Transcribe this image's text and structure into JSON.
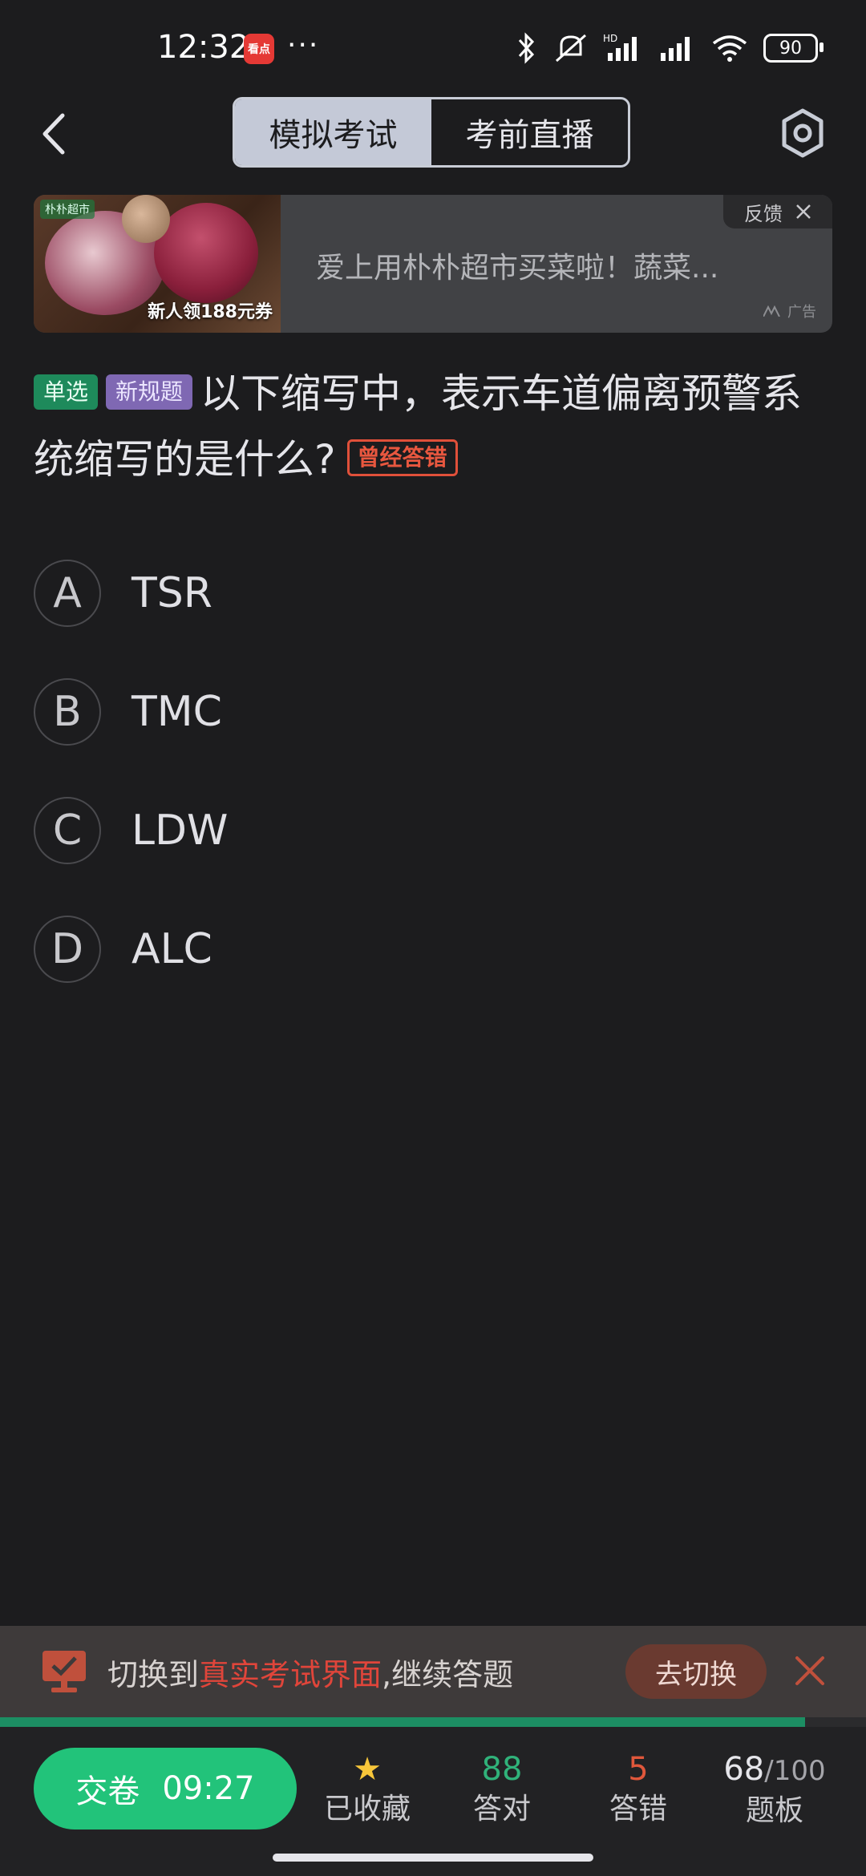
{
  "status_bar": {
    "time": "12:32",
    "app_badge": "看点",
    "more": "···",
    "network": "HD",
    "battery": "90"
  },
  "nav": {
    "tabs": [
      {
        "label": "模拟考试",
        "active": true
      },
      {
        "label": "考前直播",
        "active": false
      }
    ]
  },
  "ad": {
    "brand": "朴朴超市",
    "promo": "新人领188元券",
    "text": "爱上用朴朴超市买菜啦！蔬菜...",
    "feedback": "反馈",
    "ad_label": "广告"
  },
  "question": {
    "type_tag": "单选",
    "rule_tag": "新规题",
    "text": "以下缩写中，表示车道偏离预警系统缩写的是什么?",
    "wrong_tag": "曾经答错",
    "options": [
      {
        "letter": "A",
        "text": "TSR"
      },
      {
        "letter": "B",
        "text": "TMC"
      },
      {
        "letter": "C",
        "text": "LDW"
      },
      {
        "letter": "D",
        "text": "ALC"
      }
    ]
  },
  "switch_bar": {
    "prefix": "切换到",
    "highlight": "真实考试界面",
    "suffix": ",继续答题",
    "button": "去切换"
  },
  "progress": {
    "fraction": 0.93
  },
  "bottom": {
    "submit_label": "交卷",
    "timer": "09:27",
    "favorite_label": "已收藏",
    "correct_count": "88",
    "correct_label": "答对",
    "wrong_count": "5",
    "wrong_label": "答错",
    "current": "68",
    "total": "/100",
    "board_label": "题板"
  },
  "colors": {
    "background": "#1c1c1e",
    "accent_green": "#22c37a",
    "error_red": "#e0453a"
  }
}
